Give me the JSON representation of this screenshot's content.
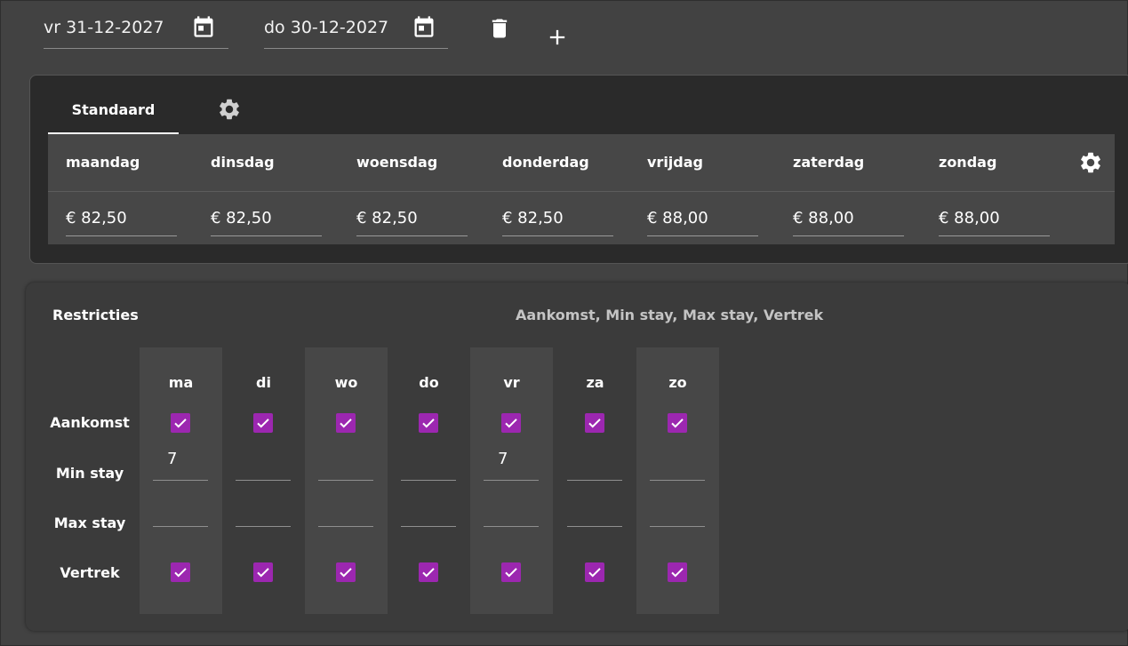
{
  "toolbar": {
    "start_date": "vr 31-12-2027",
    "end_date": "do 30-12-2027",
    "icons": [
      "calendar-icon",
      "calendar-icon",
      "trash-icon",
      "plus-icon"
    ]
  },
  "pricing": {
    "tab_label": "Standaard",
    "days": [
      "maandag",
      "dinsdag",
      "woensdag",
      "donderdag",
      "vrijdag",
      "zaterdag",
      "zondag"
    ],
    "prices": [
      "€ 82,50",
      "€ 82,50",
      "€ 82,50",
      "€ 82,50",
      "€ 88,00",
      "€ 88,00",
      "€ 88,00"
    ]
  },
  "restrictions": {
    "title": "Restricties",
    "summary": "Aankomst, Min stay, Max stay, Vertrek",
    "days": [
      "ma",
      "di",
      "wo",
      "do",
      "vr",
      "za",
      "zo"
    ],
    "row_labels": {
      "arrival": "Aankomst",
      "min_stay": "Min stay",
      "max_stay": "Max stay",
      "departure": "Vertrek"
    },
    "arrival": [
      true,
      true,
      true,
      true,
      true,
      true,
      true
    ],
    "min_stay": [
      "7",
      "",
      "",
      "",
      "7",
      "",
      ""
    ],
    "max_stay": [
      "",
      "",
      "",
      "",
      "",
      "",
      ""
    ],
    "departure": [
      true,
      true,
      true,
      true,
      true,
      true,
      true
    ]
  },
  "colors": {
    "background": "#424242",
    "card": "#2a2a2a",
    "checkbox": "#9c27b0"
  }
}
